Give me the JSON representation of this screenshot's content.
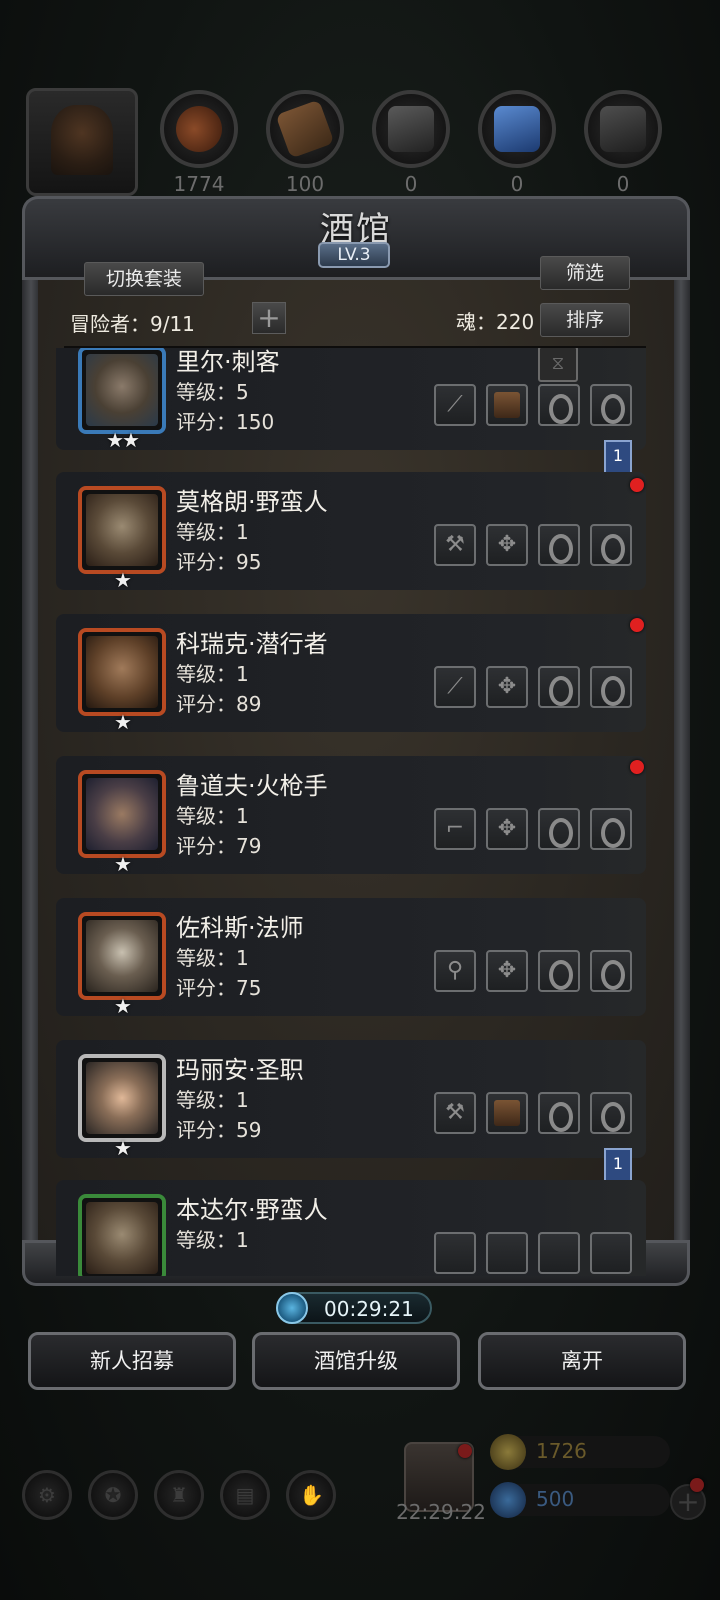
{
  "resources": [
    {
      "name": "hood-icon",
      "count": ""
    },
    {
      "name": "meat-icon",
      "count": "1774"
    },
    {
      "name": "wood-icon",
      "count": "100"
    },
    {
      "name": "iron-icon",
      "count": "0"
    },
    {
      "name": "crystal-icon",
      "count": "0"
    },
    {
      "name": "anvil-icon",
      "count": "0"
    }
  ],
  "tavern": {
    "title": "酒馆",
    "level": "LV.3"
  },
  "controls": {
    "switch_outfit": "切换套装",
    "filter": "筛选",
    "sort": "排序",
    "adventurers": "冒险者：9/11",
    "soul": "魂：220"
  },
  "heroes": [
    {
      "name": "里尔·刺客",
      "level": "等级：5",
      "score": "评分：150",
      "stars": "★★"
    },
    {
      "name": "莫格朗·野蛮人",
      "level": "等级：1",
      "score": "评分：95",
      "stars": "★"
    },
    {
      "name": "科瑞克·潜行者",
      "level": "等级：1",
      "score": "评分：89",
      "stars": "★"
    },
    {
      "name": "鲁道夫·火枪手",
      "level": "等级：1",
      "score": "评分：79",
      "stars": "★"
    },
    {
      "name": "佐科斯·法师",
      "level": "等级：1",
      "score": "评分：75",
      "stars": "★"
    },
    {
      "name": "玛丽安·圣职",
      "level": "等级：1",
      "score": "评分：59",
      "stars": "★"
    },
    {
      "name": "本达尔·野蛮人",
      "level": "等级：1",
      "score": "",
      "stars": ""
    }
  ],
  "ribbons": [
    "1",
    "1"
  ],
  "timer": "00:29:21",
  "actions": {
    "recruit": "新人招募",
    "upgrade": "酒馆升级",
    "leave": "离开"
  },
  "bottom": {
    "gift_time": "22:29:22",
    "gold": "1726",
    "gems": "500"
  },
  "colors": {
    "frame": "#4a4c50",
    "parchment": "#2c2822",
    "card": "#1e2024",
    "alert": "#e02020",
    "ribbon": "#2e4a80",
    "timer": "#5ab4e0"
  }
}
